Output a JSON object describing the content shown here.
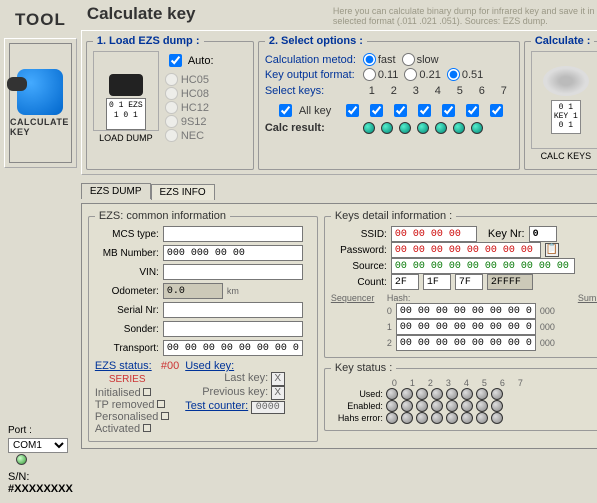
{
  "tool": {
    "title": "TOOL",
    "button_label": "CALCULATE KEY",
    "port_label": "Port :",
    "port_value": "COM1",
    "sn_label": "S/N:",
    "sn_value": "#XXXXXXXX"
  },
  "main": {
    "title": "Calculate key",
    "hint": "Here you can calculate binary dump for infrared key and save it in selected format (.011 .021 .051). Sources: EZS dump."
  },
  "load": {
    "legend": "1. Load EZS dump :",
    "auto_label": "Auto:",
    "button_label": "LOAD DUMP",
    "sheet_text": "0 1\nEZS\n1 0 1",
    "mcus": [
      "HC05",
      "HC08",
      "HC12",
      "9S12",
      "NEC"
    ]
  },
  "options": {
    "legend": "2. Select options :",
    "method_label": "Calculation metod:",
    "method_fast": "fast",
    "method_slow": "slow",
    "format_label": "Key output format:",
    "fmt1": "0.11",
    "fmt2": "0.21",
    "fmt3": "0.51",
    "select_label": "Select keys:",
    "allkey_label": "All key",
    "nums": [
      "1",
      "2",
      "3",
      "4",
      "5",
      "6",
      "7"
    ],
    "calc_result_label": "Calc result:"
  },
  "calc": {
    "legend": "Calculate :",
    "button_label": "CALC KEYS",
    "key_text": "0 1\nKEY\n1 0 1"
  },
  "tabs": {
    "t1": "EZS DUMP",
    "t2": "EZS INFO"
  },
  "ezs": {
    "legend": "EZS: common information",
    "mcs_label": "MCS type:",
    "mb_label": "MB Number:",
    "mb_value": "000 000 00 00",
    "vin_label": "VIN:",
    "odo_label": "Odometer:",
    "odo_value": "0.0",
    "odo_unit": "km",
    "serial_label": "Serial Nr:",
    "sonder_label": "Sonder:",
    "transport_label": "Transport:",
    "transport_value": "00 00 00 00 00 00 00 00"
  },
  "keys": {
    "legend": "Keys detail information :",
    "ssid_label": "SSID:",
    "ssid_value": "00 00 00 00",
    "keynr_label": "Key Nr:",
    "keynr_value": "0",
    "pwd_label": "Password:",
    "pwd_value": "00 00 00 00 00 00 00 00",
    "src_label": "Source:",
    "src_value": "00 00 00 00 00 00 00 00 00 00 00 00",
    "count_label": "Count:",
    "count_a": "2F",
    "count_b": "1F",
    "count_c": "7F",
    "count_d": "2FFFF",
    "seq_label": "Sequencer",
    "hash_label": "Hash:",
    "sum_label": "Sum:",
    "hash_zero": "00 00 00 00 00 00 00 00",
    "sum_zero": "000",
    "hlead": [
      "0",
      "1",
      "2"
    ]
  },
  "status": {
    "ezs_status_label": "EZS status:",
    "ezs_status_val": "#00",
    "series": "SERIES",
    "flags": [
      "Initialised",
      "TP removed",
      "Personalised",
      "Activated"
    ],
    "used_key_label": "Used key:",
    "last_key": "Last key:",
    "prev_key": "Previous key:",
    "test_counter": "Test counter:",
    "test_counter_val": "0000"
  },
  "keystatus": {
    "legend": "Key status :",
    "cols": [
      "0",
      "1",
      "2",
      "3",
      "4",
      "5",
      "6",
      "7"
    ],
    "used": "Used:",
    "enabled": "Enabled:",
    "hash_error": "Hahs error:"
  }
}
